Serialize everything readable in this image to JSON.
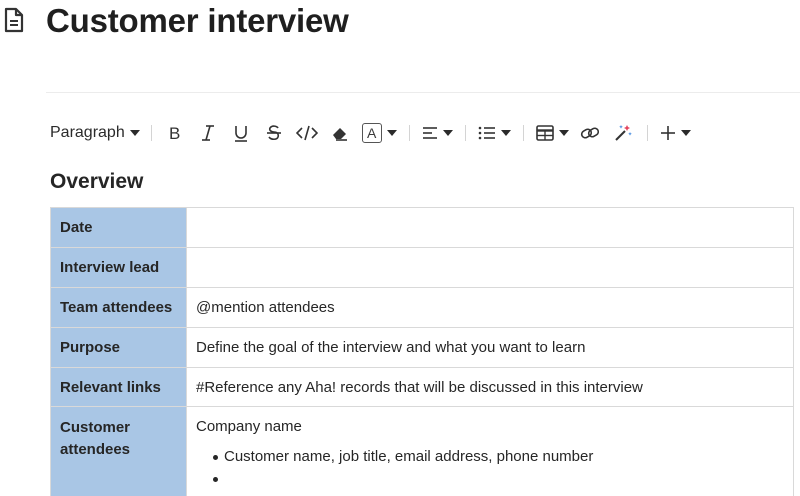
{
  "page": {
    "title": "Customer interview"
  },
  "toolbar": {
    "paragraph_label": "Paragraph",
    "text_color_label": "A",
    "icons": [
      "bold-icon",
      "italic-icon",
      "underline-icon",
      "strikethrough-icon",
      "code-icon",
      "eraser-icon",
      "text-color-icon",
      "align-left-icon",
      "bulleted-list-icon",
      "table-icon",
      "link-icon",
      "magic-wand-icon",
      "plus-icon"
    ]
  },
  "overview": {
    "heading": "Overview",
    "rows": [
      {
        "label": "Date",
        "value": ""
      },
      {
        "label": "Interview lead",
        "value": ""
      },
      {
        "label": "Team attendees",
        "value": "@mention attendees"
      },
      {
        "label": "Purpose",
        "value": "Define the goal of the interview and what you want to learn"
      },
      {
        "label": "Relevant links",
        "value": "#Reference any Aha! records that will be discussed in this interview"
      },
      {
        "label": "Customer attendees",
        "value": "Company name",
        "bullets": [
          "Customer name, job title, email address, phone number",
          ""
        ]
      }
    ]
  },
  "colors": {
    "label_bg": "#a9c6e5",
    "border": "#d9d9d9",
    "text": "#262626"
  }
}
